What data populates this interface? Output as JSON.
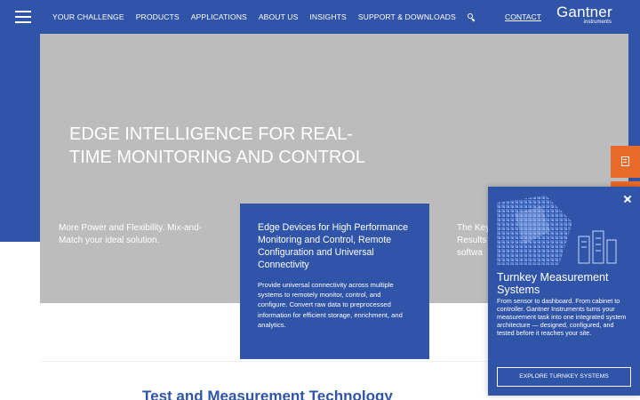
{
  "header": {
    "menu_icon": "hamburger-icon",
    "nav": [
      {
        "label": "YOUR CHALLENGE"
      },
      {
        "label": "PRODUCTS"
      },
      {
        "label": "APPLICATIONS"
      },
      {
        "label": "ABOUT US"
      },
      {
        "label": "INSIGHTS"
      },
      {
        "label": "SUPPORT & DOWNLOADS"
      }
    ],
    "search_icon": "search-icon",
    "contact_label": "CONTACT",
    "logo": {
      "main": "Gantner",
      "sub": "instruments"
    }
  },
  "hero": {
    "title": "EDGE INTELLIGENCE FOR REAL-TIME MONITORING AND CONTROL",
    "col1_text": "More Power and Flexibility. Mix-and-Match your ideal solution.",
    "col3_lines": [
      "The Key",
      "Results",
      "softwa"
    ],
    "card": {
      "title": "Edge Devices for High Performance Monitoring and Control, Remote Configuration and Universal Connectivity",
      "text": "Provide universal connectivity across multiple systems to remotely monitor, control, and configure. Convert raw data to preprocessed information for efficient storage, enrichment, and analytics."
    }
  },
  "side_buttons": {
    "icon": "document-icon"
  },
  "section_title": "Test and Measurement Technology",
  "popup": {
    "close_icon": "close-icon",
    "title": "Turnkey Measurement Systems",
    "text": "From sensor to dashboard. From cabinet to controller. Gantner Instruments turns your measurement task into one integrated system architecture — designed, configured, and tested before it reaches your site.",
    "button_label": "EXPLORE TURNKEY SYSTEMS"
  },
  "colors": {
    "brand_blue": "#2f54a8",
    "hero_gray": "#bcbcbc",
    "accent_orange": "#e96a2a"
  }
}
